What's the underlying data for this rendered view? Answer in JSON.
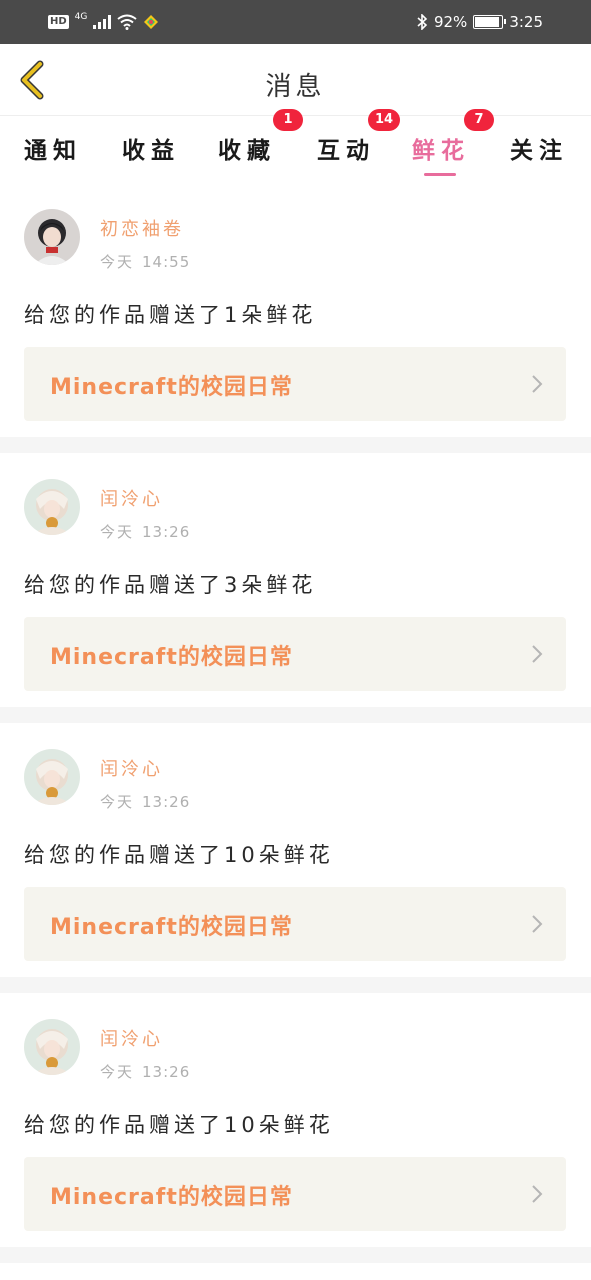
{
  "status_bar": {
    "hd": "HD",
    "network": "4G",
    "battery": "92%",
    "time": "3:25",
    "battery_level": 0.92,
    "icons": [
      "signal-icon",
      "wifi-icon",
      "app-notification-icon",
      "bluetooth-icon",
      "battery-icon"
    ]
  },
  "header": {
    "title": "消息",
    "back_icon": "chevron-left-icon",
    "back_icon_color": "#e8c020"
  },
  "tabs": [
    {
      "label": "通知"
    },
    {
      "label": "收益"
    },
    {
      "label": "收藏",
      "badge": "1"
    },
    {
      "label": "互动",
      "badge": "14"
    },
    {
      "label": "鲜花",
      "badge": "7",
      "active": true
    },
    {
      "label": "关注"
    }
  ],
  "colors": {
    "accent": "#e86c9c",
    "badge": "#f0243c",
    "username": "#f0a070",
    "work_title": "#f39058",
    "work_bg": "#f5f4ee"
  },
  "messages": [
    {
      "user": "初恋袖卷",
      "day": "今天",
      "time": "14:55",
      "text": "给您的作品赠送了1朵鲜花",
      "work": "Minecraft的校园日常",
      "avatar_icon": "user-avatar-icon"
    },
    {
      "user": "闰泠心",
      "day": "今天",
      "time": "13:26",
      "text": "给您的作品赠送了3朵鲜花",
      "work": "Minecraft的校园日常",
      "avatar_icon": "user-avatar-icon"
    },
    {
      "user": "闰泠心",
      "day": "今天",
      "time": "13:26",
      "text": "给您的作品赠送了10朵鲜花",
      "work": "Minecraft的校园日常",
      "avatar_icon": "user-avatar-icon"
    },
    {
      "user": "闰泠心",
      "day": "今天",
      "time": "13:26",
      "text": "给您的作品赠送了10朵鲜花",
      "work": "Minecraft的校园日常",
      "avatar_icon": "user-avatar-icon"
    }
  ]
}
